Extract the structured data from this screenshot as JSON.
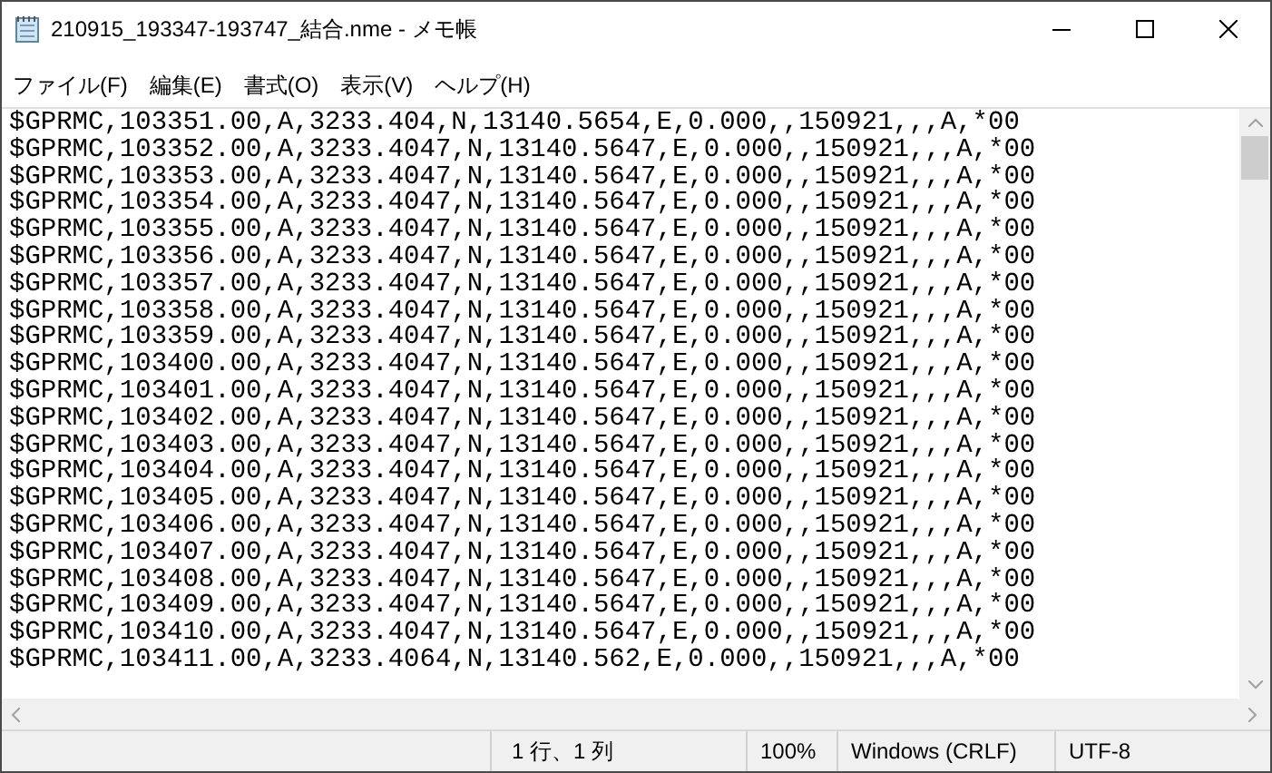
{
  "window": {
    "title": "210915_193347-193747_結合.nme - メモ帳"
  },
  "menu": [
    "ファイル(F)",
    "編集(E)",
    "書式(O)",
    "表示(V)",
    "ヘルプ(H)"
  ],
  "lines": [
    "$GPRMC,103351.00,A,3233.404,N,13140.5654,E,0.000,,150921,,,A,*00",
    "$GPRMC,103352.00,A,3233.4047,N,13140.5647,E,0.000,,150921,,,A,*00",
    "$GPRMC,103353.00,A,3233.4047,N,13140.5647,E,0.000,,150921,,,A,*00",
    "$GPRMC,103354.00,A,3233.4047,N,13140.5647,E,0.000,,150921,,,A,*00",
    "$GPRMC,103355.00,A,3233.4047,N,13140.5647,E,0.000,,150921,,,A,*00",
    "$GPRMC,103356.00,A,3233.4047,N,13140.5647,E,0.000,,150921,,,A,*00",
    "$GPRMC,103357.00,A,3233.4047,N,13140.5647,E,0.000,,150921,,,A,*00",
    "$GPRMC,103358.00,A,3233.4047,N,13140.5647,E,0.000,,150921,,,A,*00",
    "$GPRMC,103359.00,A,3233.4047,N,13140.5647,E,0.000,,150921,,,A,*00",
    "$GPRMC,103400.00,A,3233.4047,N,13140.5647,E,0.000,,150921,,,A,*00",
    "$GPRMC,103401.00,A,3233.4047,N,13140.5647,E,0.000,,150921,,,A,*00",
    "$GPRMC,103402.00,A,3233.4047,N,13140.5647,E,0.000,,150921,,,A,*00",
    "$GPRMC,103403.00,A,3233.4047,N,13140.5647,E,0.000,,150921,,,A,*00",
    "$GPRMC,103404.00,A,3233.4047,N,13140.5647,E,0.000,,150921,,,A,*00",
    "$GPRMC,103405.00,A,3233.4047,N,13140.5647,E,0.000,,150921,,,A,*00",
    "$GPRMC,103406.00,A,3233.4047,N,13140.5647,E,0.000,,150921,,,A,*00",
    "$GPRMC,103407.00,A,3233.4047,N,13140.5647,E,0.000,,150921,,,A,*00",
    "$GPRMC,103408.00,A,3233.4047,N,13140.5647,E,0.000,,150921,,,A,*00",
    "$GPRMC,103409.00,A,3233.4047,N,13140.5647,E,0.000,,150921,,,A,*00",
    "$GPRMC,103410.00,A,3233.4047,N,13140.5647,E,0.000,,150921,,,A,*00",
    "$GPRMC,103411.00,A,3233.4064,N,13140.562,E,0.000,,150921,,,A,*00"
  ],
  "status_bar": {
    "position": "1 行、1 列",
    "zoom": "100%",
    "line_ending": "Windows (CRLF)",
    "encoding": "UTF-8"
  }
}
